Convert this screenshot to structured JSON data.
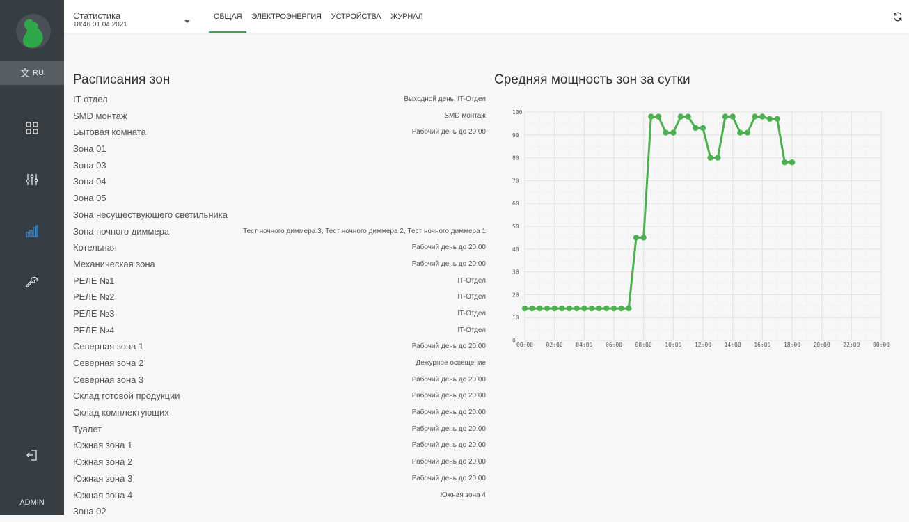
{
  "user": "ADMIN",
  "language": "RU",
  "header": {
    "page": "Статистика",
    "datetime": "18:46 01.04.2021",
    "tabs": [
      "ОБЩАЯ",
      "ЭЛЕКТРОЭНЕРГИЯ",
      "УСТРОЙСТВА",
      "ЖУРНАЛ"
    ],
    "active_tab": "ОБЩАЯ"
  },
  "sidebar": {
    "items": [
      {
        "icon": "dashboard-icon"
      },
      {
        "icon": "sliders-icon"
      },
      {
        "icon": "statistics-icon",
        "active": true
      },
      {
        "icon": "wrench-icon"
      },
      {
        "icon": "logout-icon"
      }
    ]
  },
  "schedules": {
    "title": "Расписания зон",
    "rows": [
      {
        "zone": "IT-отдел",
        "schedule": "Выходной день, IT-Отдел"
      },
      {
        "zone": "SMD монтаж",
        "schedule": "SMD монтаж"
      },
      {
        "zone": "Бытовая комната",
        "schedule": "Рабочий день до 20:00"
      },
      {
        "zone": "Зона 01",
        "schedule": ""
      },
      {
        "zone": "Зона 03",
        "schedule": ""
      },
      {
        "zone": "Зона 04",
        "schedule": ""
      },
      {
        "zone": "Зона 05",
        "schedule": ""
      },
      {
        "zone": "Зона несуществующего светильника",
        "schedule": ""
      },
      {
        "zone": "Зона ночного диммера",
        "schedule": "Тест ночного диммера 3, Тест ночного диммера 2, Тест ночного диммера 1"
      },
      {
        "zone": "Котельная",
        "schedule": "Рабочий день до 20:00"
      },
      {
        "zone": "Механическая зона",
        "schedule": "Рабочий день до 20:00"
      },
      {
        "zone": "РЕЛЕ №1",
        "schedule": "IT-Отдел"
      },
      {
        "zone": "РЕЛЕ №2",
        "schedule": "IT-Отдел"
      },
      {
        "zone": "РЕЛЕ №3",
        "schedule": "IT-Отдел"
      },
      {
        "zone": "РЕЛЕ №4",
        "schedule": "IT-Отдел"
      },
      {
        "zone": "Северная зона 1",
        "schedule": "Рабочий день до 20:00"
      },
      {
        "zone": "Северная зона 2",
        "schedule": "Дежурное освещение"
      },
      {
        "zone": "Северная зона 3",
        "schedule": "Рабочий день до 20:00"
      },
      {
        "zone": "Склад готовой продукции",
        "schedule": "Рабочий день до 20:00"
      },
      {
        "zone": "Склад комплектующих",
        "schedule": "Рабочий день до 20:00"
      },
      {
        "zone": "Туалет",
        "schedule": "Рабочий день до 20:00"
      },
      {
        "zone": "Южная зона 1",
        "schedule": "Рабочий день до 20:00"
      },
      {
        "zone": "Южная зона 2",
        "schedule": "Рабочий день до 20:00"
      },
      {
        "zone": "Южная зона 3",
        "schedule": "Рабочий день до 20:00"
      },
      {
        "zone": "Южная зона 4",
        "schedule": "Южная зона 4"
      },
      {
        "zone": "Зона 02",
        "schedule": ""
      }
    ]
  },
  "colors": {
    "accent": "#3aa35a",
    "sidebar": "#373e43",
    "series": "#4caf50",
    "active_icon": "#2f8ad8"
  },
  "chart_data": {
    "type": "line",
    "title": "Средняя мощность зон за сутки",
    "x_ticks": [
      "00:00",
      "02:00",
      "04:00",
      "06:00",
      "08:00",
      "10:00",
      "12:00",
      "14:00",
      "16:00",
      "18:00",
      "20:00",
      "22:00",
      "00:00"
    ],
    "y_ticks": [
      0,
      10,
      20,
      30,
      40,
      50,
      60,
      70,
      80,
      90,
      100
    ],
    "ylim": [
      0,
      100
    ],
    "xlim_hours": [
      0,
      24
    ],
    "grid": true,
    "series": [
      {
        "x_hours": [
          0,
          0.5,
          1,
          1.5,
          2,
          2.5,
          3,
          3.5,
          4,
          4.5,
          5,
          5.5,
          6,
          6.5,
          7,
          7.5,
          8,
          8.5,
          9,
          9.5,
          10,
          10.5,
          11,
          11.5,
          12,
          12.5,
          13,
          13.5,
          14,
          14.5,
          15,
          15.5,
          16,
          16.5,
          17,
          17.5,
          18
        ],
        "y": [
          14,
          14,
          14,
          14,
          14,
          14,
          14,
          14,
          14,
          14,
          14,
          14,
          14,
          14,
          14,
          45,
          45,
          98,
          98,
          91,
          91,
          98,
          98,
          93,
          93,
          80,
          80,
          98,
          98,
          91,
          91,
          98,
          98,
          97,
          97,
          78,
          78
        ]
      }
    ]
  }
}
